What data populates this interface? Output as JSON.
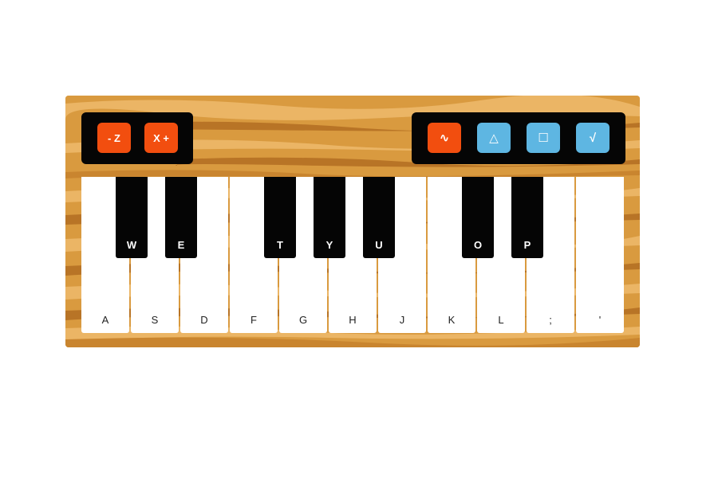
{
  "colors": {
    "wood_base": "#d99a3f",
    "wood_light": "#ebb565",
    "wood_dark": "#b87426",
    "panel": "#050505",
    "button_orange": "#f24e0f",
    "button_blue": "#5eb6e2"
  },
  "octave_buttons": [
    {
      "label": "- Z",
      "name": "octave-down-button"
    },
    {
      "label": "X +",
      "name": "octave-up-button"
    }
  ],
  "waveform_buttons": [
    {
      "label": "∿",
      "name": "sine-wave-button",
      "icon": "sine-icon",
      "active": true
    },
    {
      "label": "△",
      "name": "triangle-wave-button",
      "icon": "triangle-icon",
      "active": false
    },
    {
      "label": "☐",
      "name": "square-wave-button",
      "icon": "square-icon",
      "active": false
    },
    {
      "label": "√",
      "name": "sawtooth-wave-button",
      "icon": "sawtooth-icon",
      "active": false
    }
  ],
  "white_keys": [
    "A",
    "S",
    "D",
    "F",
    "G",
    "H",
    "J",
    "K",
    "L",
    ";",
    "'"
  ],
  "black_keys": [
    "W",
    "E",
    "T",
    "Y",
    "U",
    "O",
    "P"
  ]
}
